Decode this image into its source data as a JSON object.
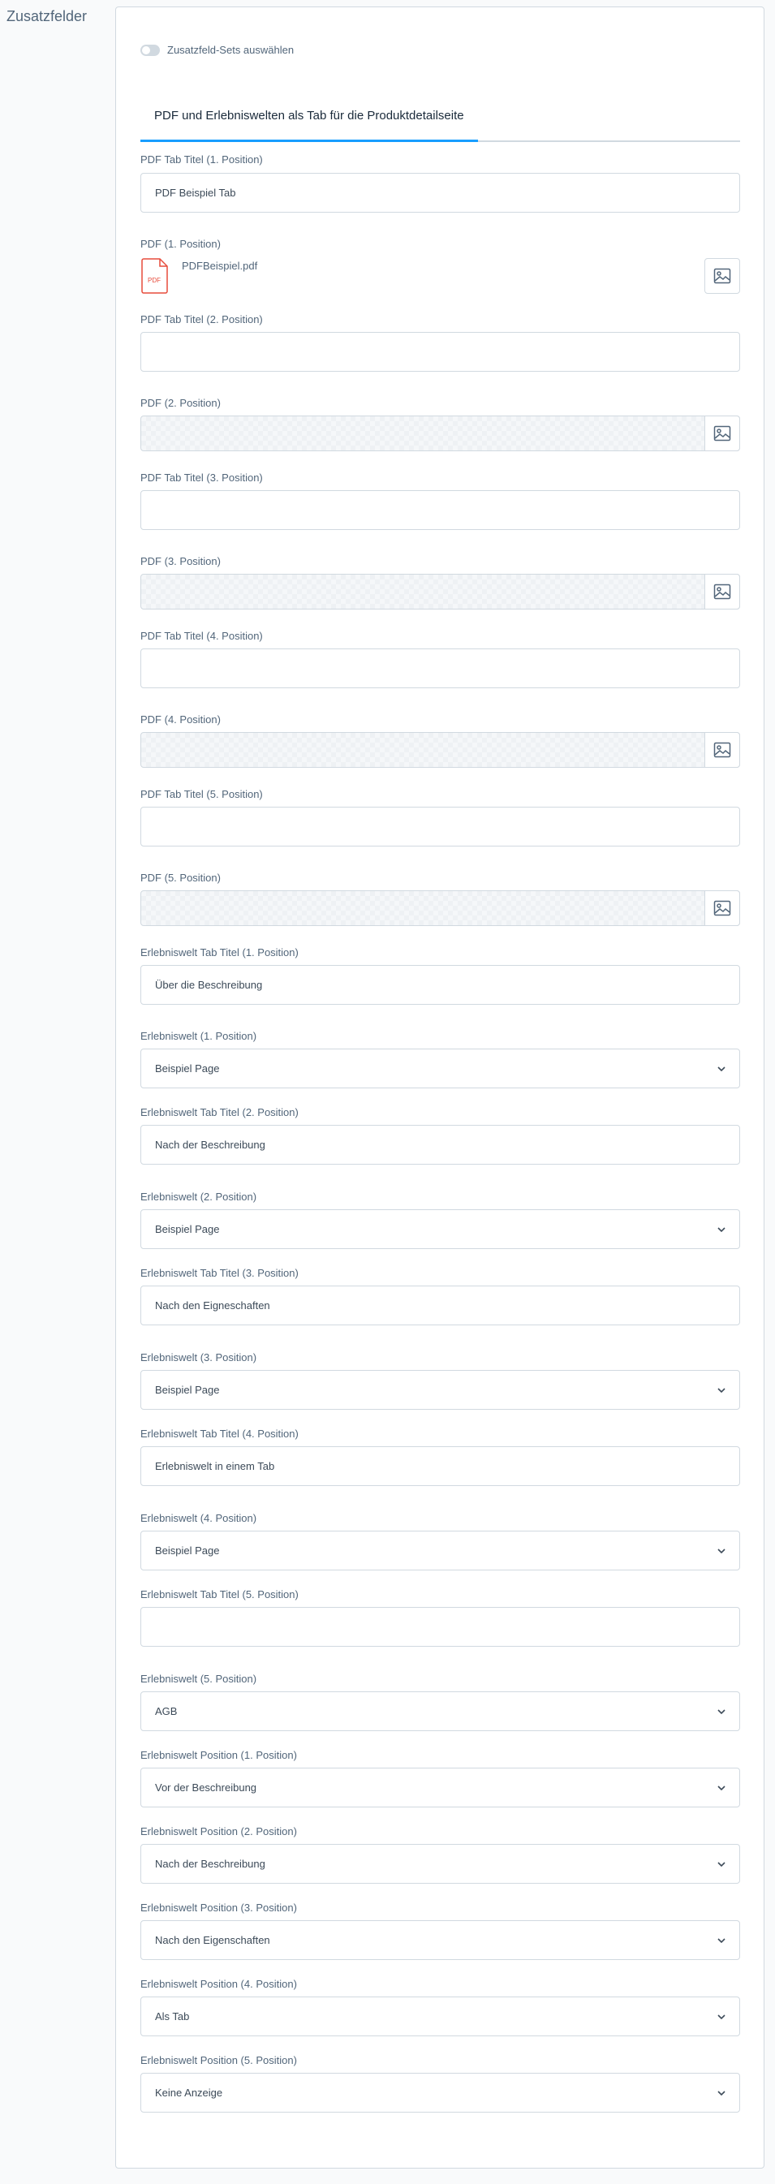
{
  "section_title": "Zusatzfelder",
  "switch_label": "Zusatzfeld-Sets auswählen",
  "tab_label": "PDF und Erlebniswelten als Tab für die Produktdetailseite",
  "pdf_tab_title_1": {
    "label": "PDF Tab Titel (1. Position)",
    "value": "PDF Beispiel Tab"
  },
  "pdf_1": {
    "label": "PDF (1. Position)",
    "file_name": "PDFBeispiel.pdf",
    "file_type": "PDF"
  },
  "pdf_tab_title_2": {
    "label": "PDF Tab Titel (2. Position)",
    "value": ""
  },
  "pdf_2": {
    "label": "PDF (2. Position)"
  },
  "pdf_tab_title_3": {
    "label": "PDF Tab Titel (3. Position)",
    "value": ""
  },
  "pdf_3": {
    "label": "PDF (3. Position)"
  },
  "pdf_tab_title_4": {
    "label": "PDF Tab Titel (4. Position)",
    "value": ""
  },
  "pdf_4": {
    "label": "PDF (4. Position)"
  },
  "pdf_tab_title_5": {
    "label": "PDF Tab Titel (5. Position)",
    "value": ""
  },
  "pdf_5": {
    "label": "PDF (5. Position)"
  },
  "ew_tab_title_1": {
    "label": "Erlebniswelt Tab Titel (1. Position)",
    "value": "Über die Beschreibung"
  },
  "ew_1": {
    "label": "Erlebniswelt (1. Position)",
    "value": "Beispiel Page"
  },
  "ew_tab_title_2": {
    "label": "Erlebniswelt Tab Titel (2. Position)",
    "value": "Nach der Beschreibung"
  },
  "ew_2": {
    "label": "Erlebniswelt (2. Position)",
    "value": "Beispiel Page"
  },
  "ew_tab_title_3": {
    "label": "Erlebniswelt Tab Titel (3. Position)",
    "value": "Nach den Eigneschaften"
  },
  "ew_3": {
    "label": "Erlebniswelt (3. Position)",
    "value": "Beispiel Page"
  },
  "ew_tab_title_4": {
    "label": "Erlebniswelt Tab Titel (4. Position)",
    "value": "Erlebniswelt in einem Tab"
  },
  "ew_4": {
    "label": "Erlebniswelt (4. Position)",
    "value": "Beispiel Page"
  },
  "ew_tab_title_5": {
    "label": "Erlebniswelt Tab Titel (5. Position)",
    "value": ""
  },
  "ew_5": {
    "label": "Erlebniswelt (5. Position)",
    "value": "AGB"
  },
  "ew_position_1": {
    "label": "Erlebniswelt Position (1. Position)",
    "value": "Vor der Beschreibung"
  },
  "ew_position_2": {
    "label": "Erlebniswelt Position (2. Position)",
    "value": "Nach der Beschreibung"
  },
  "ew_position_3": {
    "label": "Erlebniswelt Position (3. Position)",
    "value": "Nach den Eigenschaften"
  },
  "ew_position_4": {
    "label": "Erlebniswelt Position (4. Position)",
    "value": "Als Tab"
  },
  "ew_position_5": {
    "label": "Erlebniswelt Position (5. Position)",
    "value": "Keine Anzeige"
  },
  "colors": {
    "accent": "#189eff",
    "border": "#d1d9e0",
    "text": "#52667a",
    "pdf_icon": "#e74c3c"
  }
}
